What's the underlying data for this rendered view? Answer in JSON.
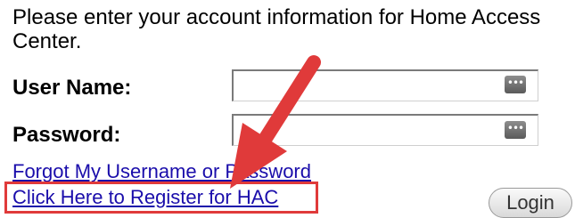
{
  "login": {
    "intro": "Please enter your account information for Home Access Center.",
    "username_label": "User Name:",
    "username_value": "",
    "password_label": "Password:",
    "password_value": "",
    "password_key_icon": "•••",
    "forgot_link": "Forgot My Username or Password",
    "register_link": "Click Here to Register for HAC",
    "login_button": "Login"
  },
  "annotation": {
    "arrow_color": "#e03a3a",
    "highlight_color": "#e03a3a",
    "icon": "arrow-icon"
  }
}
